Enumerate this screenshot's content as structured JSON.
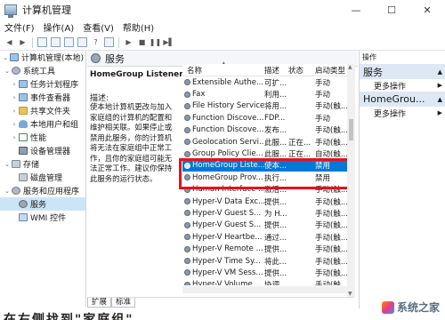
{
  "window": {
    "title": "计算机管理"
  },
  "window_controls": {
    "minimize": "—",
    "maximize": "☐",
    "close": "✕"
  },
  "menu": [
    "文件(F)",
    "操作(A)",
    "查看(V)",
    "帮助(H)"
  ],
  "tree": {
    "root": "计算机管理(本地)",
    "items": [
      {
        "label": "系统工具",
        "level": 1,
        "expanded": true,
        "icon": "tools-icon"
      },
      {
        "label": "任务计划程序",
        "level": 2,
        "icon": "task-scheduler-icon"
      },
      {
        "label": "事件查看器",
        "level": 2,
        "icon": "event-viewer-icon"
      },
      {
        "label": "共享文件夹",
        "level": 2,
        "icon": "shared-folder-icon"
      },
      {
        "label": "本地用户和组",
        "level": 2,
        "icon": "users-icon"
      },
      {
        "label": "性能",
        "level": 2,
        "icon": "performance-icon"
      },
      {
        "label": "设备管理器",
        "level": 2,
        "icon": "device-manager-icon"
      },
      {
        "label": "存储",
        "level": 1,
        "expanded": true,
        "icon": "storage-icon"
      },
      {
        "label": "磁盘管理",
        "level": 2,
        "icon": "disk-icon"
      },
      {
        "label": "服务和应用程序",
        "level": 1,
        "expanded": true,
        "icon": "apps-icon"
      },
      {
        "label": "服务",
        "level": 2,
        "selected": true,
        "icon": "services-icon"
      },
      {
        "label": "WMI 控件",
        "level": 2,
        "icon": "wmi-icon"
      }
    ]
  },
  "services_panel": {
    "header": "服务",
    "selected_name": "HomeGroup Listener",
    "description_label": "描述:",
    "description": "使本地计算机更改与加入家庭组的计算机的配置和维护相关联。如果停止或禁用此服务，你的计算机将无法在家庭组中正常工作，且你的家庭组可能无法正常工作。建议你保持此服务的运行状态。",
    "columns": [
      "名称",
      "描述",
      "状态",
      "启动类型"
    ],
    "rows": [
      {
        "name": "Extensible Authe...",
        "desc": "可扩...",
        "status": "",
        "startup": "手动"
      },
      {
        "name": "Fax",
        "desc": "利用...",
        "status": "",
        "startup": "手动"
      },
      {
        "name": "File History Service",
        "desc": "将用...",
        "status": "",
        "startup": "手动(触..."
      },
      {
        "name": "Function Discove...",
        "desc": "FDP...",
        "status": "",
        "startup": "手动"
      },
      {
        "name": "Function Discove...",
        "desc": "发布...",
        "status": "",
        "startup": "手动(触..."
      },
      {
        "name": "Geolocation Servi...",
        "desc": "此服...",
        "status": "正在...",
        "startup": "手动(触..."
      },
      {
        "name": "Group Policy Clie...",
        "desc": "此服...",
        "status": "正在...",
        "startup": "自动(触..."
      },
      {
        "name": "HomeGroup Liste...",
        "desc": "使本...",
        "status": "",
        "startup": "禁用",
        "selected": true
      },
      {
        "name": "HomeGroup Prov...",
        "desc": "执行...",
        "status": "",
        "startup": "禁用"
      },
      {
        "name": "Human Interface ...",
        "desc": "激活...",
        "status": "",
        "startup": "手动(触..."
      },
      {
        "name": "Hyper-V Data Exc...",
        "desc": "提供...",
        "status": "",
        "startup": "手动(触..."
      },
      {
        "name": "Hyper-V Guest S...",
        "desc": "为 H...",
        "status": "",
        "startup": "手动(触..."
      },
      {
        "name": "Hyper-V Guest S...",
        "desc": "提供...",
        "status": "",
        "startup": "手动(触..."
      },
      {
        "name": "Hyper-V Heartbe...",
        "desc": "通过...",
        "status": "",
        "startup": "手动(触..."
      },
      {
        "name": "Hyper-V Remote ...",
        "desc": "提供...",
        "status": "",
        "startup": "手动(触..."
      },
      {
        "name": "Hyper-V Time Sy...",
        "desc": "将此...",
        "status": "",
        "startup": "手动(触..."
      },
      {
        "name": "Hyper-V VM Sess...",
        "desc": "提供...",
        "status": "",
        "startup": "手动(触..."
      },
      {
        "name": "Hyper-V Volume ...",
        "desc": "协调...",
        "status": "",
        "startup": "手动(触..."
      }
    ],
    "tabs": [
      "扩展",
      "标准"
    ]
  },
  "actions_panel": {
    "header": "操作",
    "sections": [
      {
        "title": "服务",
        "items": [
          "更多操作"
        ]
      },
      {
        "title": "HomeGrou...",
        "items": [
          "更多操作"
        ]
      }
    ]
  },
  "bottom_text": "在右侧找到\"家庭组\"",
  "watermark": "系统之家"
}
